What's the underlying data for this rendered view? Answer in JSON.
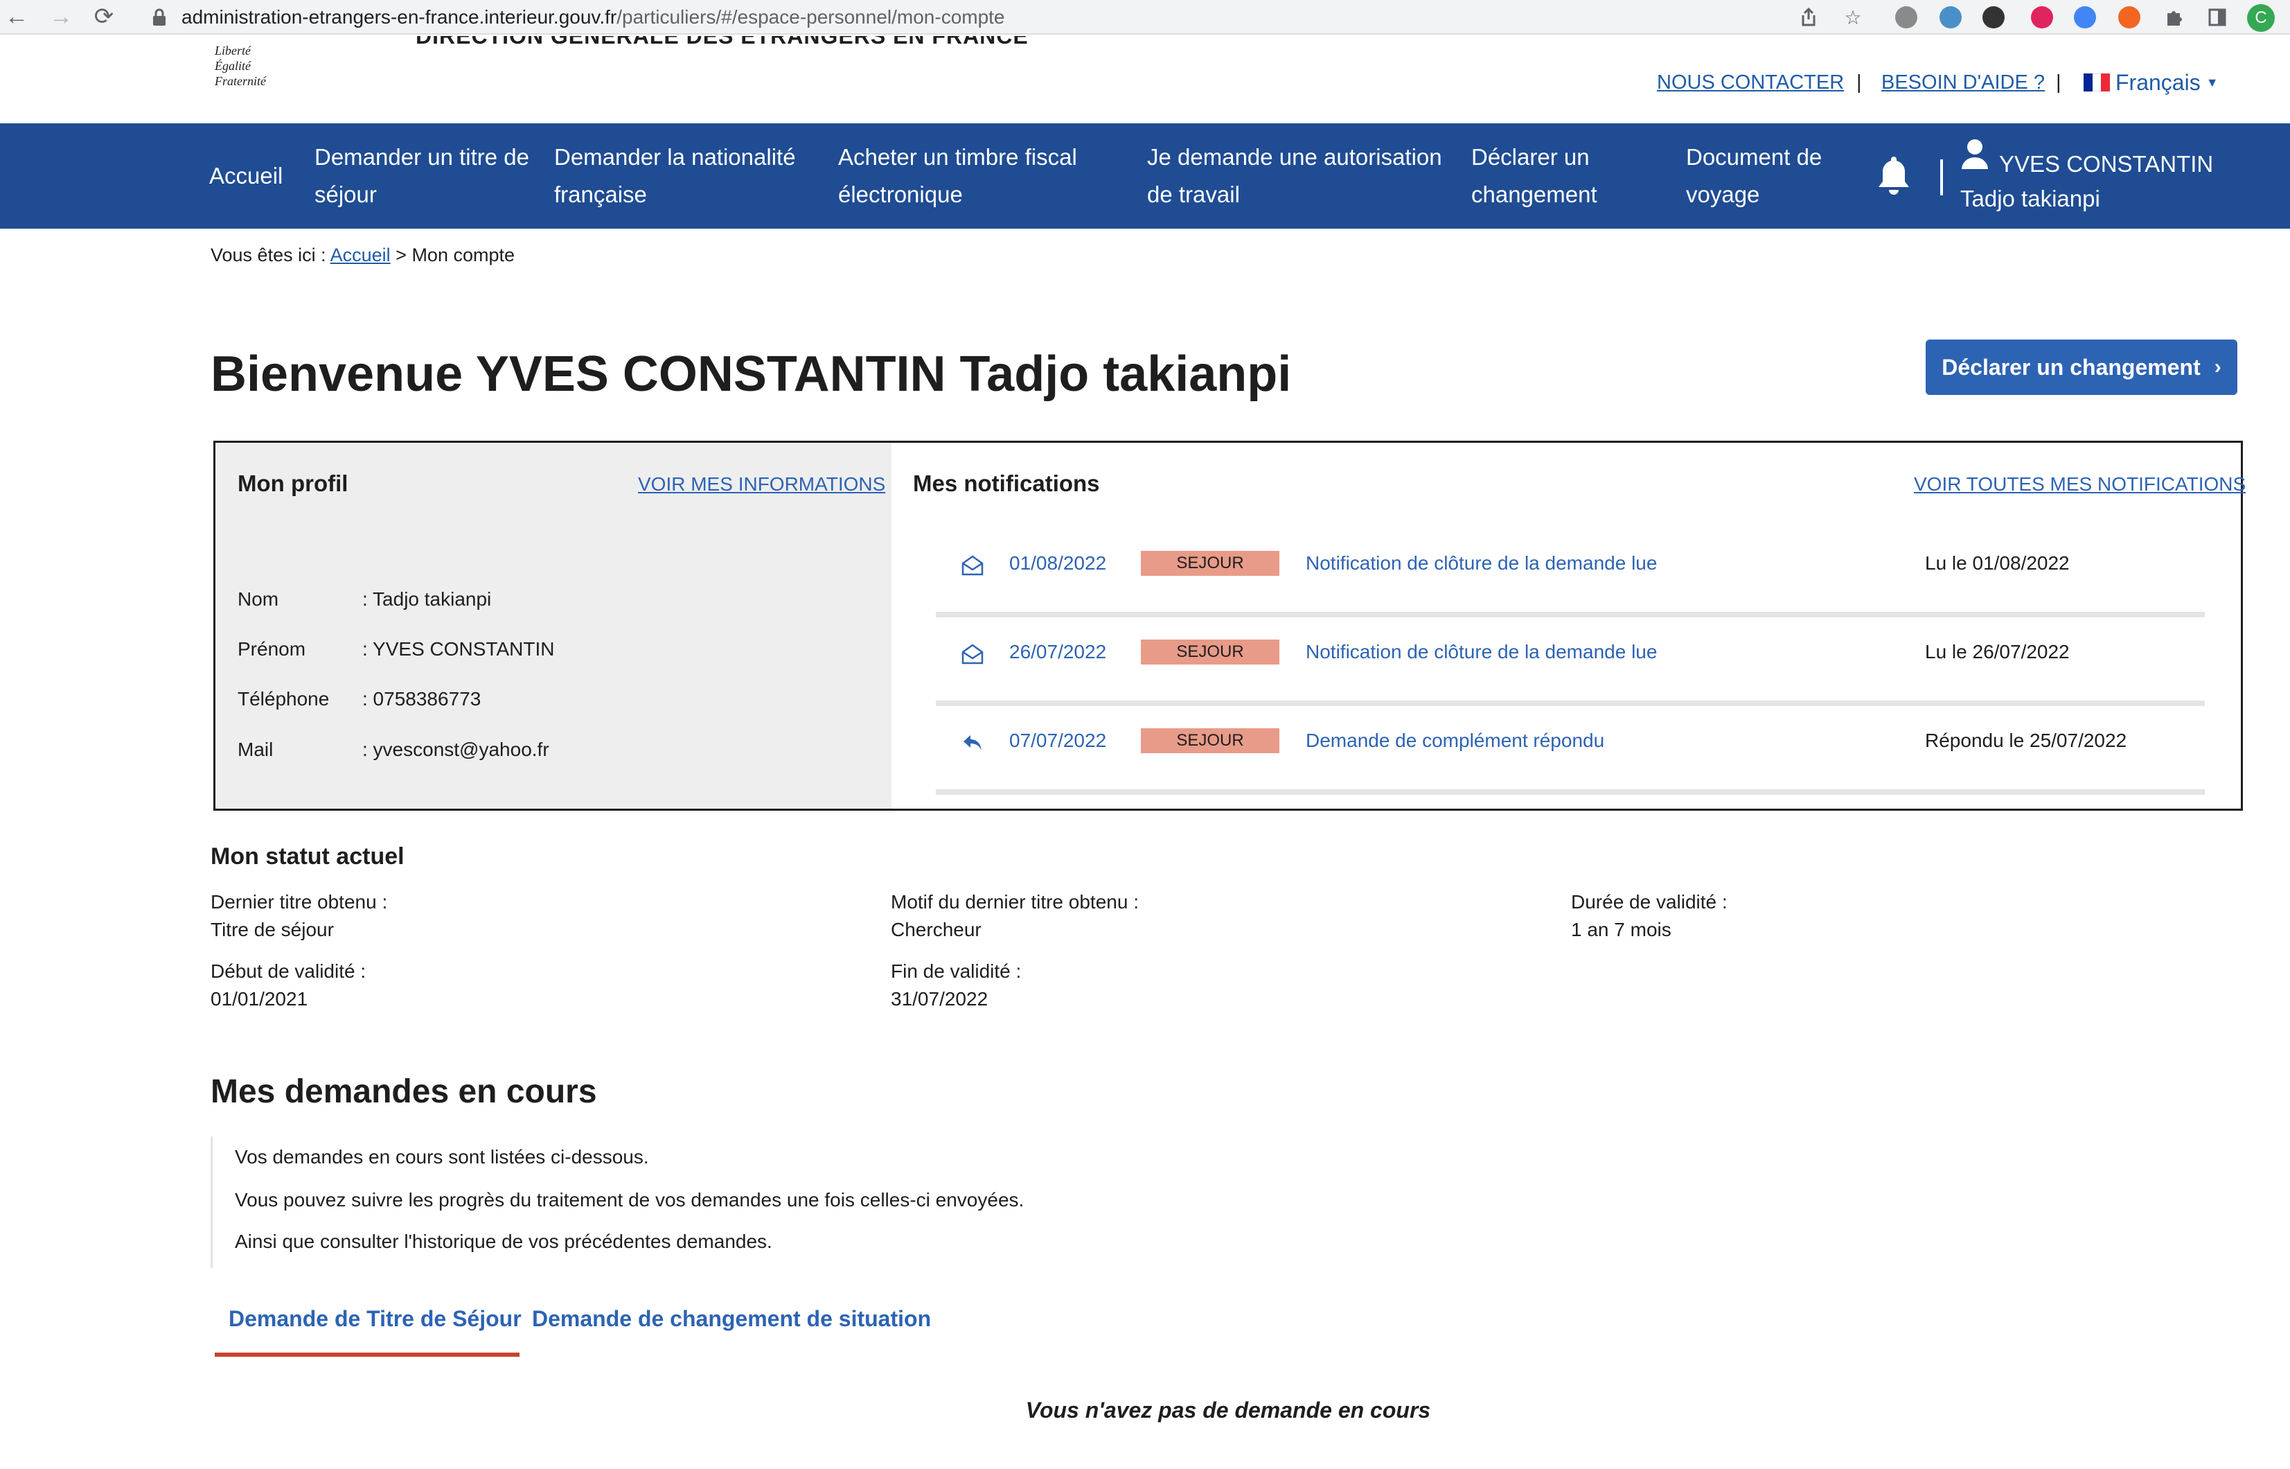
{
  "browser": {
    "url_host": "administration-etrangers-en-france.interieur.gouv.fr",
    "url_path": "/particuliers/#/espace-personnel/mon-compte",
    "profile_initial": "C"
  },
  "header": {
    "motto": [
      "Liberté",
      "Égalité",
      "Fraternité"
    ],
    "direction": "DIRECTION GÉNÉRALE DES ÉTRANGERS EN FRANCE",
    "contact_link": "NOUS CONTACTER",
    "separator": "|",
    "help_link": "BESOIN D'AIDE ?",
    "language": "Français",
    "flag_colors": [
      "#002395",
      "#ffffff",
      "#ed2939"
    ]
  },
  "nav": {
    "home": "Accueil",
    "items": [
      [
        "Demander un titre de",
        "séjour"
      ],
      [
        "Demander la nationalité",
        "française"
      ],
      [
        "Acheter un timbre fiscal",
        "électronique"
      ],
      [
        "Je demande une autorisation",
        "de travail"
      ],
      [
        "Déclarer un",
        "changement"
      ],
      [
        "Document de",
        "voyage"
      ]
    ],
    "user_name": "YVES CONSTANTIN",
    "user_sub": "Tadjo takianpi",
    "bg_color": "#1f4c93"
  },
  "breadcrumb": {
    "prefix": "Vous êtes ici :",
    "home": "Accueil",
    "current": "> Mon compte"
  },
  "welcome": {
    "title": "Bienvenue YVES CONSTANTIN Tadjo takianpi",
    "declare_button": "Déclarer un changement"
  },
  "profile": {
    "title": "Mon profil",
    "link": "VOIR MES INFORMATIONS",
    "fields": [
      {
        "label": "Nom",
        "value": ": Tadjo takianpi"
      },
      {
        "label": "Prénom",
        "value": ": YVES CONSTANTIN"
      },
      {
        "label": "Téléphone",
        "value": ": 0758386773"
      },
      {
        "label": "Mail",
        "value": ": yvesconst@yahoo.fr"
      }
    ]
  },
  "notifications": {
    "title": "Mes notifications",
    "link": "VOIR TOUTES MES NOTIFICATIONS",
    "badge_color": "#e89b88",
    "items": [
      {
        "icon": "envelope-open-icon",
        "date": "01/08/2022",
        "badge": "SEJOUR",
        "text": "Notification de clôture de la demande lue",
        "status": "Lu le 01/08/2022"
      },
      {
        "icon": "envelope-open-icon",
        "date": "26/07/2022",
        "badge": "SEJOUR",
        "text": "Notification de clôture de la demande lue",
        "status": "Lu le 26/07/2022"
      },
      {
        "icon": "reply-icon",
        "date": "07/07/2022",
        "badge": "SEJOUR",
        "text": "Demande de complément répondu",
        "status": "Répondu le 25/07/2022"
      }
    ]
  },
  "status": {
    "title": "Mon statut actuel",
    "items": [
      {
        "label": "Dernier titre obtenu :",
        "value": "Titre de séjour"
      },
      {
        "label": "Motif du dernier titre obtenu :",
        "value": "Chercheur"
      },
      {
        "label": "Durée de validité :",
        "value": "1 an 7 mois"
      },
      {
        "label": "Début de validité :",
        "value": "01/01/2021"
      },
      {
        "label": "Fin de validité :",
        "value": "31/07/2022"
      }
    ]
  },
  "requests": {
    "title": "Mes demandes en cours",
    "info": [
      "Vos demandes en cours sont listées ci-dessous.",
      "Vous pouvez suivre les progrès du traitement de vos demandes une fois celles-ci envoyées.",
      "Ainsi que consulter l'historique de vos précédentes demandes."
    ],
    "tabs": [
      "Demande de Titre de Séjour",
      "Demande de changement de situation"
    ],
    "active_tab_color": "#c8432b",
    "empty": "Vous n'avez pas de demande en cours"
  }
}
